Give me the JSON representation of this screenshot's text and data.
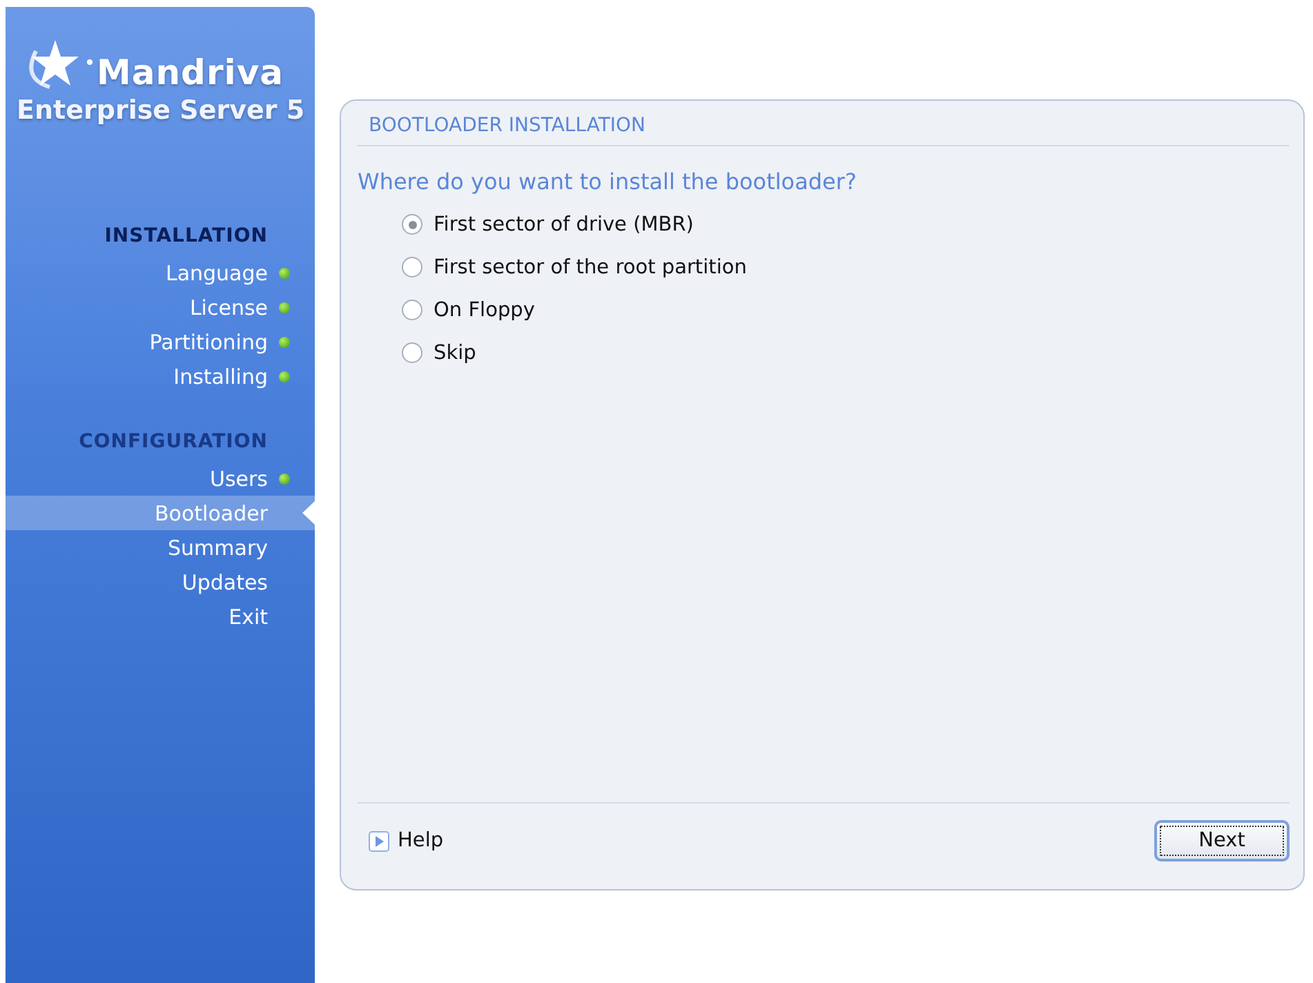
{
  "sidebar": {
    "logo": {
      "brand": "Mandriva",
      "product": "Enterprise Server 5"
    },
    "sections": [
      {
        "title": "INSTALLATION",
        "active": true,
        "items": [
          {
            "label": "Language",
            "done": true,
            "selected": false
          },
          {
            "label": "License",
            "done": true,
            "selected": false
          },
          {
            "label": "Partitioning",
            "done": true,
            "selected": false
          },
          {
            "label": "Installing",
            "done": true,
            "selected": false
          }
        ]
      },
      {
        "title": "CONFIGURATION",
        "active": false,
        "items": [
          {
            "label": "Users",
            "done": true,
            "selected": false
          },
          {
            "label": "Bootloader",
            "done": false,
            "selected": true
          },
          {
            "label": "Summary",
            "done": false,
            "selected": false
          },
          {
            "label": "Updates",
            "done": false,
            "selected": false
          },
          {
            "label": "Exit",
            "done": false,
            "selected": false
          }
        ]
      }
    ]
  },
  "panel": {
    "title": "BOOTLOADER INSTALLATION",
    "question": "Where do you want to install the bootloader?",
    "options": [
      {
        "label": "First sector of drive (MBR)",
        "selected": true
      },
      {
        "label": "First sector of the root partition",
        "selected": false
      },
      {
        "label": "On Floppy",
        "selected": false
      },
      {
        "label": "Skip",
        "selected": false
      }
    ],
    "help": "Help",
    "next": "Next"
  }
}
